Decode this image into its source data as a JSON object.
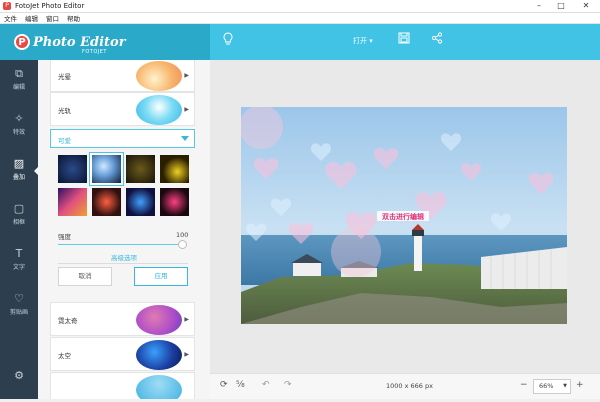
{
  "window": {
    "title": "FotoJet Photo Editor",
    "icon": "P"
  },
  "menu": [
    "文件",
    "编辑",
    "窗口",
    "帮助"
  ],
  "brand": {
    "name": "Photo Editor",
    "sub": "FOTOJET",
    "logo": "P"
  },
  "toolbar": {
    "open_label": "打开 ▾"
  },
  "nav": [
    {
      "label": "编辑",
      "icon": "⧉"
    },
    {
      "label": "特效",
      "icon": "✧"
    },
    {
      "label": "叠加",
      "icon": "▨"
    },
    {
      "label": "相框",
      "icon": "▢"
    },
    {
      "label": "文字",
      "icon": "T"
    },
    {
      "label": "剪贴画",
      "icon": "♡"
    }
  ],
  "panel": {
    "categories": [
      {
        "label": "光晕"
      },
      {
        "label": "光轨"
      },
      {
        "label": "霓太奇"
      },
      {
        "label": "太空"
      }
    ],
    "selected_category": "可爱",
    "strength_label": "强度",
    "strength_value": "100",
    "strength_level": 1.0,
    "advanced_label": "高级选项",
    "cancel_label": "取消",
    "apply_label": "应用"
  },
  "canvas": {
    "overlay_text": "双击进行编辑",
    "dimensions": "1000 x 666 px",
    "zoom": "66%"
  }
}
